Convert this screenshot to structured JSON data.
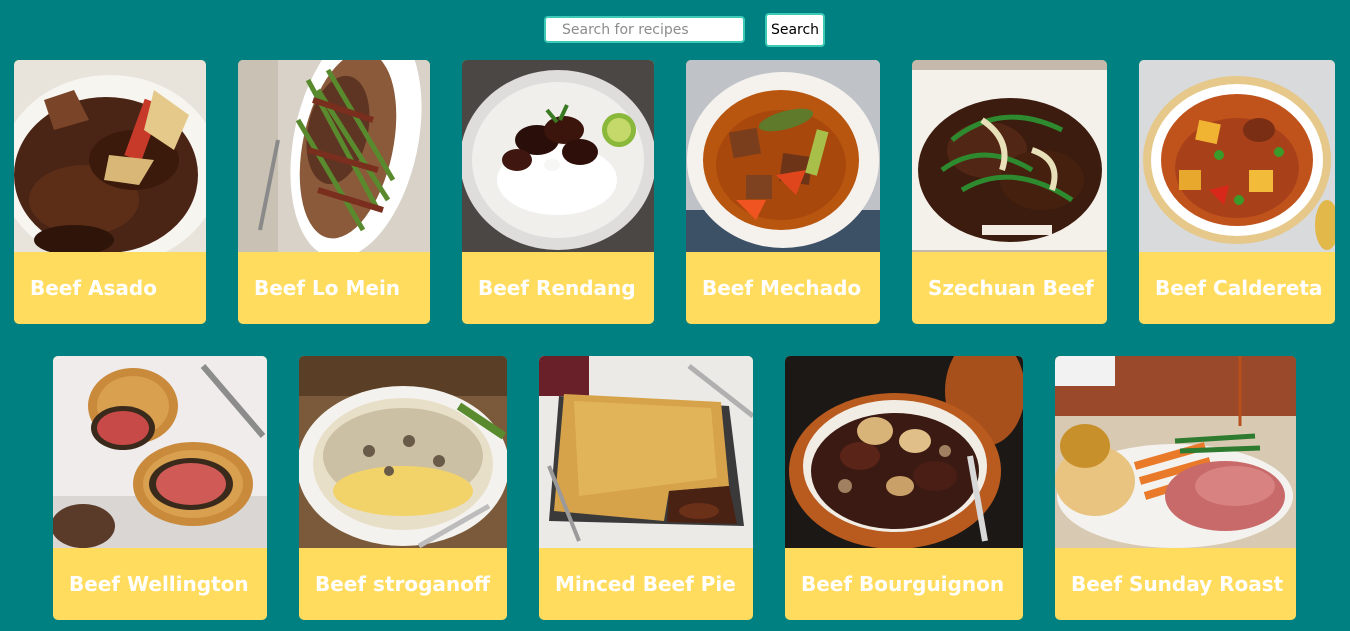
{
  "search": {
    "placeholder": "Search for recipes",
    "value": "",
    "button_label": "Search"
  },
  "recipes": [
    {
      "title": "Beef Asado"
    },
    {
      "title": "Beef Lo Mein"
    },
    {
      "title": "Beef Rendang"
    },
    {
      "title": "Beef Mechado"
    },
    {
      "title": "Szechuan Beef"
    },
    {
      "title": "Beef Caldereta"
    },
    {
      "title": "Beef Wellington"
    },
    {
      "title": "Beef stroganoff"
    },
    {
      "title": "Minced Beef Pie"
    },
    {
      "title": "Beef Bourguignon"
    },
    {
      "title": "Beef Sunday Roast"
    }
  ],
  "colors": {
    "background": "#008080",
    "card": "#ffdc5e",
    "search_border": "#3cc9b6",
    "title_text": "#ffffff"
  }
}
